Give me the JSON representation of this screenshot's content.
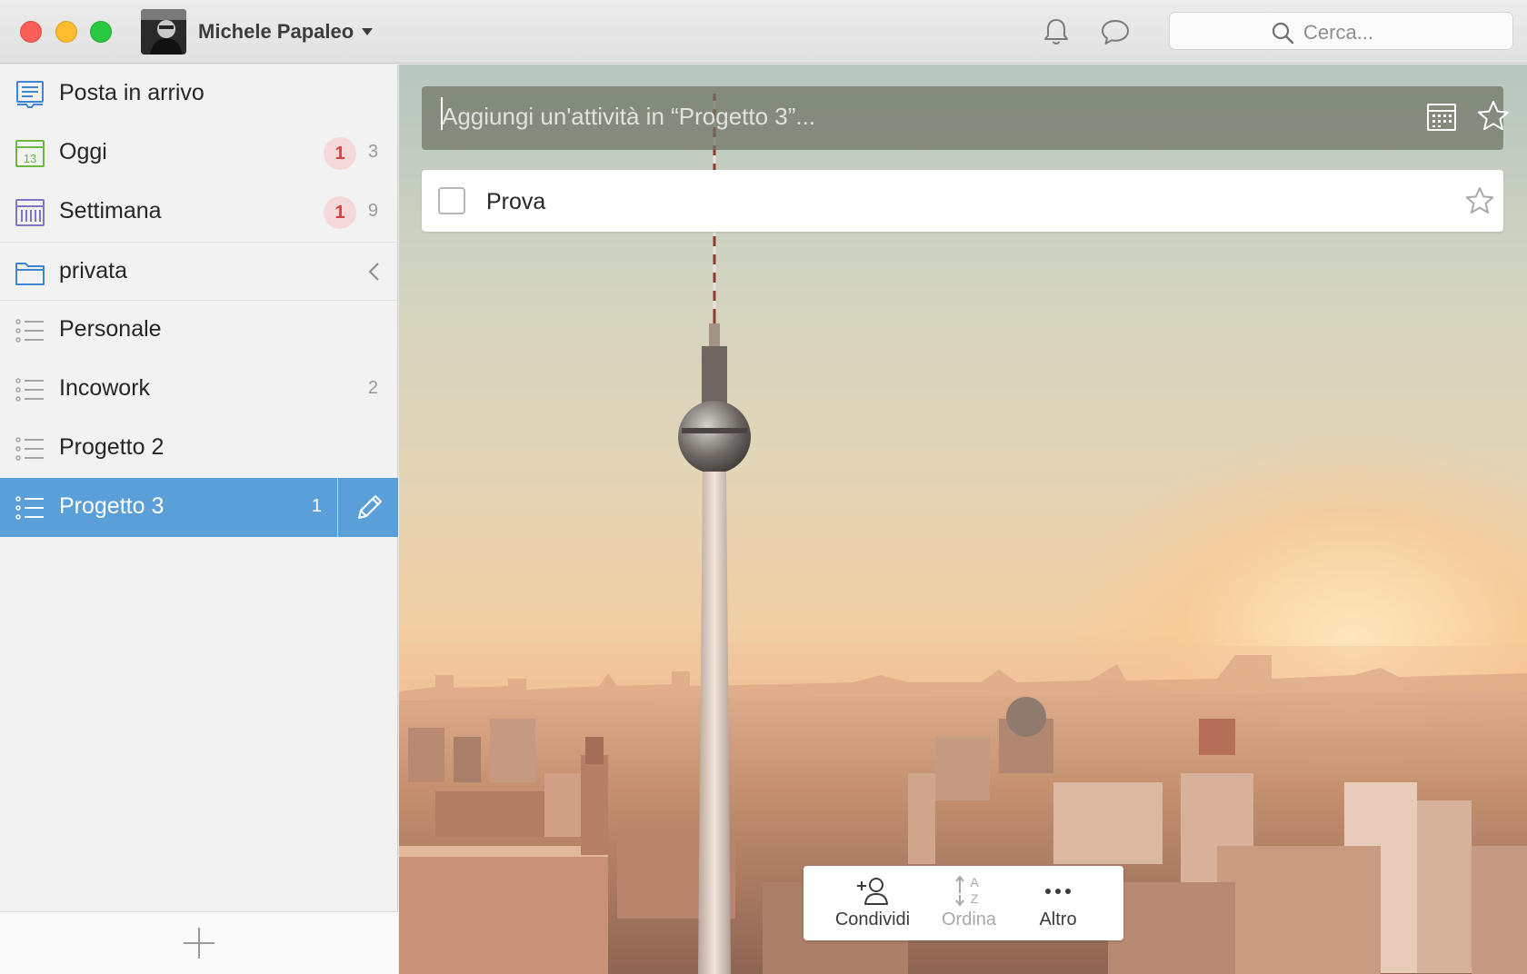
{
  "window": {
    "user": {
      "name": "Michele Papaleo"
    },
    "search": {
      "placeholder": "Cerca..."
    },
    "icons": [
      "bell-icon",
      "chat-bubble-icon",
      "search-icon",
      "chevron-down-icon"
    ]
  },
  "sidebar": {
    "smart_lists": [
      {
        "label": "Posta in arrivo",
        "icon": "inbox-icon",
        "badge": "",
        "count": ""
      },
      {
        "label": "Oggi",
        "icon": "calendar-today-icon",
        "calendar_day": "13",
        "badge": "1",
        "count": "3"
      },
      {
        "label": "Settimana",
        "icon": "calendar-week-icon",
        "badge": "1",
        "count": "9"
      }
    ],
    "folder": {
      "label": "privata",
      "icon": "folder-icon",
      "expanded": false
    },
    "lists": [
      {
        "label": "Personale",
        "count": ""
      },
      {
        "label": "Incowork",
        "count": "2"
      },
      {
        "label": "Progetto 2",
        "count": ""
      },
      {
        "label": "Progetto 3",
        "count": "1",
        "active": true
      }
    ],
    "colors": {
      "active_bg": "#5b9fd9",
      "badge_bg": "#f5d9d9",
      "badge_text": "#d64142",
      "today_icon": "#6cb93f",
      "week_icon": "#7f77c4",
      "inbox_icon": "#3e86d1"
    }
  },
  "main": {
    "add_task": {
      "placeholder": "Aggiungi un'attività in “Progetto 3”..."
    },
    "tasks": [
      {
        "label": "Prova",
        "done": false,
        "starred": false
      }
    ],
    "toolbar": {
      "share_label": "Condividi",
      "sort_label": "Ordina",
      "more_label": "Altro"
    }
  }
}
